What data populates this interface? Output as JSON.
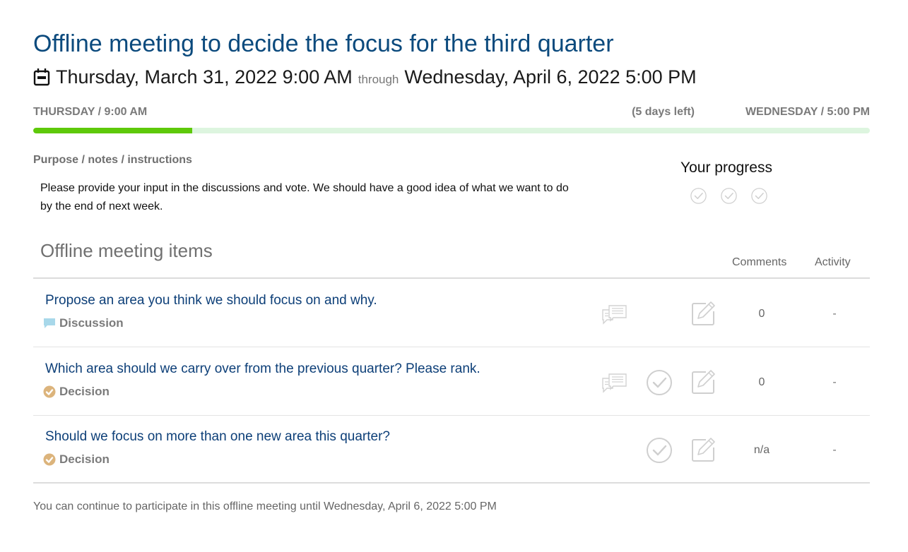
{
  "meeting": {
    "title": "Offline meeting to decide the focus for the third quarter",
    "start": "Thursday, March 31, 2022 9:00 AM",
    "through_label": "through",
    "end": "Wednesday, April 6, 2022 5:00 PM",
    "icon": "calendar-icon"
  },
  "timeline": {
    "start_label": "THURSDAY / 9:00 AM",
    "time_left": "(5 days left)",
    "end_label": "WEDNESDAY / 5:00 PM",
    "progress_percent": 19,
    "fill_color": "#5ec90a",
    "track_color": "#ddf5df"
  },
  "notes": {
    "label": "Purpose / notes / instructions",
    "text": "Please provide your input in the discussions and vote. We should have a good idea of what we want to do by the end of next week."
  },
  "your_progress": {
    "label": "Your progress",
    "steps": [
      {
        "icon": "check-circle-icon",
        "done": false
      },
      {
        "icon": "check-circle-icon",
        "done": false
      },
      {
        "icon": "check-circle-icon",
        "done": false
      }
    ]
  },
  "items_section": {
    "title": "Offline meeting items",
    "columns": {
      "comments": "Comments",
      "activity": "Activity"
    }
  },
  "items": [
    {
      "title": "Propose an area you think we should focus on and why.",
      "type": "Discussion",
      "type_icon": "speech-bubble-icon",
      "type_color": "#a8d8ea",
      "has_discussion_icon": true,
      "has_vote_icon": false,
      "has_edit_icon": true,
      "comments": "0",
      "activity": "-"
    },
    {
      "title": "Which area should we carry over from the previous quarter? Please rank.",
      "type": "Decision",
      "type_icon": "check-badge-icon",
      "type_color": "#dcb47c",
      "has_discussion_icon": true,
      "has_vote_icon": true,
      "has_edit_icon": true,
      "comments": "0",
      "activity": "-"
    },
    {
      "title": "Should we focus on more than one new area this quarter?",
      "type": "Decision",
      "type_icon": "check-badge-icon",
      "type_color": "#dcb47c",
      "has_discussion_icon": false,
      "has_vote_icon": true,
      "has_edit_icon": true,
      "comments": "n/a",
      "activity": "-"
    }
  ],
  "footer": {
    "note": "You can continue to participate in this offline meeting until Wednesday, April 6, 2022 5:00 PM"
  }
}
